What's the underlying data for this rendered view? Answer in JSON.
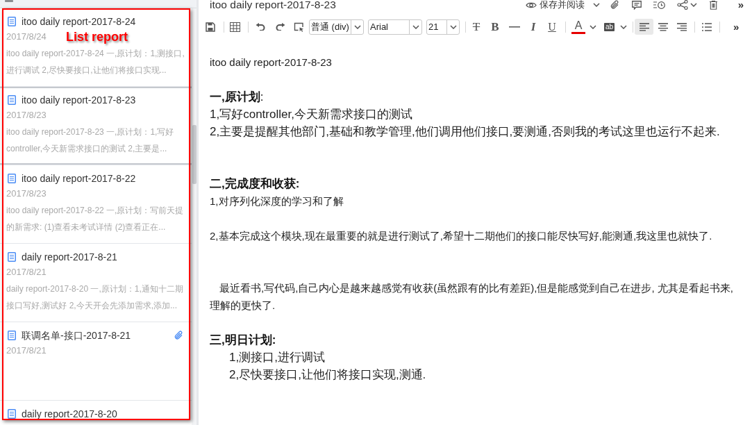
{
  "note_list": {
    "items": [
      {
        "title": "itoo daily report-2017-8-24",
        "date": "2017/8/24",
        "preview": "itoo daily report-2017-8-24 一,原计划：1,测接口,进行调试 2,尽快要接口,让他们将接口实现...",
        "selected": false,
        "attachment": false
      },
      {
        "title": "itoo daily report-2017-8-23",
        "date": "2017/8/23",
        "preview": "itoo daily report-2017-8-23 一,原计划：1,写好controller,今天新需求接口的测试 2,主要是...",
        "selected": true,
        "attachment": false
      },
      {
        "title": "itoo daily report-2017-8-22",
        "date": "2017/8/23",
        "preview": "itoo daily report-2017-8-22 一,原计划：写前天提的新需求: (1)查看未考试详情 (2)查看正在...",
        "selected": false,
        "attachment": false
      },
      {
        "title": "daily report-2017-8-21",
        "date": "2017/8/21",
        "preview": "daily report-2017-8-20 一,原计划：1,通知十二期接口写好,测试好 2,今天开会先添加需求,添加...",
        "selected": false,
        "attachment": false
      },
      {
        "title": "联调名单-接口-2017-8-21",
        "date": "2017/8/21",
        "selected": false,
        "attachment": true
      },
      {
        "title": "daily report-2017-8-20",
        "selected": false,
        "attachment": false
      }
    ]
  },
  "annotation": {
    "label": "List report"
  },
  "editor": {
    "title": "itoo daily report-2017-8-23",
    "save_and_read": "保存并阅读",
    "more": "»",
    "toolbar": {
      "block_format": "普通 (div)",
      "font": "Arial",
      "font_size": "21",
      "strikethrough": "T",
      "bold": "B",
      "italic": "I",
      "underline": "U",
      "font_color": "A",
      "highlight": "ab",
      "alignment": [
        {
          "selected": true
        },
        {
          "selected": false
        },
        {
          "selected": false
        }
      ],
      "more": "»"
    }
  },
  "document": {
    "blocks": [
      {
        "kind": "title",
        "text": "itoo daily report-2017-8-23"
      },
      {
        "kind": "blank"
      },
      {
        "kind": "rich_heading",
        "text": "**一,原计划**:"
      },
      {
        "kind": "text",
        "text": "1,写好controller,今天新需求接口的测试"
      },
      {
        "kind": "text",
        "text": "2,主要是提醒其他部门,基础和教学管理,他们调用他们接口,要测通,否则我的考试这里也运行不起来."
      },
      {
        "kind": "blank"
      },
      {
        "kind": "blank"
      },
      {
        "kind": "heading",
        "text": "二,完成度和收获:"
      },
      {
        "kind": "small",
        "text": "1,对序列化深度的学习和了解"
      },
      {
        "kind": "blank"
      },
      {
        "kind": "small",
        "text": "2,基本完成这个模块,现在最重要的就是进行测试了,希望十二期他们的接口能尽快写好,能测通,我这里也就快了."
      },
      {
        "kind": "blank"
      },
      {
        "kind": "blank"
      },
      {
        "kind": "small_indented",
        "text": "最近看书,写代码,自己内心是越来越感觉有收获(虽然跟有的比有差距),但是能感觉到自己在进步, 尤其是看起书来,理解的更快了."
      },
      {
        "kind": "blank"
      },
      {
        "kind": "heading",
        "text": "三,明日计划:"
      },
      {
        "kind": "indented",
        "text": "1,测接口,进行调试"
      },
      {
        "kind": "indented",
        "text": "2,尽快要接口,让他们将接口实现,测通."
      }
    ]
  }
}
